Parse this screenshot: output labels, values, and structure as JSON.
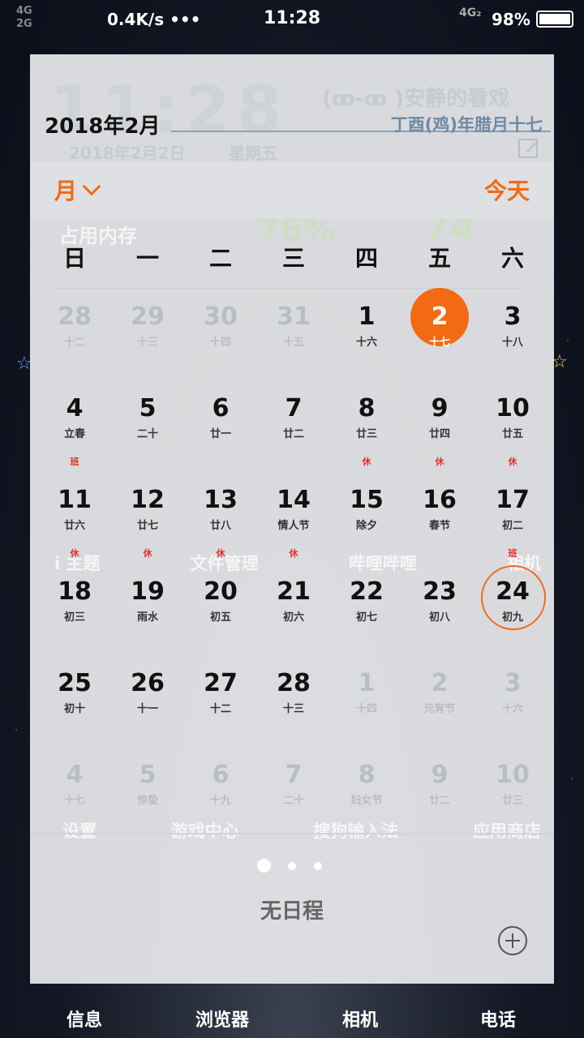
{
  "status_bar": {
    "signal_1": "4G",
    "signal_2": "2G",
    "net_speed": "0.4K/s",
    "dots": "•••",
    "time": "11:28",
    "network": "4G₂",
    "battery": "98%"
  },
  "calendar": {
    "header_date": "2018年2月",
    "header_lunar": "丁酉(鸡)年腊月十七",
    "view_mode": "月",
    "today_label": "今天",
    "weekdays": [
      "日",
      "一",
      "二",
      "三",
      "四",
      "五",
      "六"
    ],
    "weeks": [
      [
        {
          "num": "28",
          "lunar": "十二",
          "tag": "",
          "dim": true
        },
        {
          "num": "29",
          "lunar": "十三",
          "tag": "",
          "dim": true
        },
        {
          "num": "30",
          "lunar": "十四",
          "tag": "",
          "dim": true
        },
        {
          "num": "31",
          "lunar": "十五",
          "tag": "",
          "dim": true
        },
        {
          "num": "1",
          "lunar": "十六",
          "tag": ""
        },
        {
          "num": "2",
          "lunar": "十七",
          "tag": "",
          "selected": true
        },
        {
          "num": "3",
          "lunar": "十八",
          "tag": ""
        }
      ],
      [
        {
          "num": "4",
          "lunar": "立春",
          "tag": ""
        },
        {
          "num": "5",
          "lunar": "二十",
          "tag": ""
        },
        {
          "num": "6",
          "lunar": "廿一",
          "tag": ""
        },
        {
          "num": "7",
          "lunar": "廿二",
          "tag": ""
        },
        {
          "num": "8",
          "lunar": "廿三",
          "tag": ""
        },
        {
          "num": "9",
          "lunar": "廿四",
          "tag": ""
        },
        {
          "num": "10",
          "lunar": "廿五",
          "tag": ""
        }
      ],
      [
        {
          "num": "11",
          "lunar": "廿六",
          "tag": "班"
        },
        {
          "num": "12",
          "lunar": "廿七",
          "tag": ""
        },
        {
          "num": "13",
          "lunar": "廿八",
          "tag": ""
        },
        {
          "num": "14",
          "lunar": "情人节",
          "tag": ""
        },
        {
          "num": "15",
          "lunar": "除夕",
          "tag": "休"
        },
        {
          "num": "16",
          "lunar": "春节",
          "tag": "休"
        },
        {
          "num": "17",
          "lunar": "初二",
          "tag": "休"
        }
      ],
      [
        {
          "num": "18",
          "lunar": "初三",
          "tag": "休"
        },
        {
          "num": "19",
          "lunar": "雨水",
          "tag": "休"
        },
        {
          "num": "20",
          "lunar": "初五",
          "tag": "休"
        },
        {
          "num": "21",
          "lunar": "初六",
          "tag": "休"
        },
        {
          "num": "22",
          "lunar": "初七",
          "tag": ""
        },
        {
          "num": "23",
          "lunar": "初八",
          "tag": ""
        },
        {
          "num": "24",
          "lunar": "初九",
          "tag": "班",
          "today": true
        }
      ],
      [
        {
          "num": "25",
          "lunar": "初十",
          "tag": ""
        },
        {
          "num": "26",
          "lunar": "十一",
          "tag": ""
        },
        {
          "num": "27",
          "lunar": "十二",
          "tag": ""
        },
        {
          "num": "28",
          "lunar": "十三",
          "tag": ""
        },
        {
          "num": "1",
          "lunar": "十四",
          "tag": "",
          "dim": true
        },
        {
          "num": "2",
          "lunar": "元宵节",
          "tag": "",
          "dim": true
        },
        {
          "num": "3",
          "lunar": "十六",
          "tag": "",
          "dim": true
        }
      ],
      [
        {
          "num": "4",
          "lunar": "十七",
          "tag": "",
          "dim": true
        },
        {
          "num": "5",
          "lunar": "惊蛰",
          "tag": "",
          "dim": true
        },
        {
          "num": "6",
          "lunar": "十九",
          "tag": "",
          "dim": true
        },
        {
          "num": "7",
          "lunar": "二十",
          "tag": "",
          "dim": true
        },
        {
          "num": "8",
          "lunar": "妇女节",
          "tag": "",
          "dim": true
        },
        {
          "num": "9",
          "lunar": "廿二",
          "tag": "",
          "dim": true
        },
        {
          "num": "10",
          "lunar": "廿三",
          "tag": "",
          "dim": true
        }
      ]
    ],
    "no_events": "无日程",
    "colors": {
      "accent": "#f26a14",
      "holiday_tag": "#e0302a"
    }
  },
  "background_ghost": {
    "clock": "11:28",
    "mood": "(ꝏ-ꝏ )安静的看戏",
    "date": "2018年2月2日",
    "weekday": "星期五",
    "memory_label": "占用内存",
    "memory_value": "76%",
    "temp": "74",
    "apps_row1": [
      "i 主题",
      "文件管理",
      "哔哩哔哩",
      "相机"
    ],
    "apps_row2": [
      "设置",
      "游戏中心",
      "搜狗输入法",
      "应用商店"
    ]
  },
  "dock": {
    "labels": [
      "信息",
      "浏览器",
      "相机",
      "电话"
    ]
  }
}
